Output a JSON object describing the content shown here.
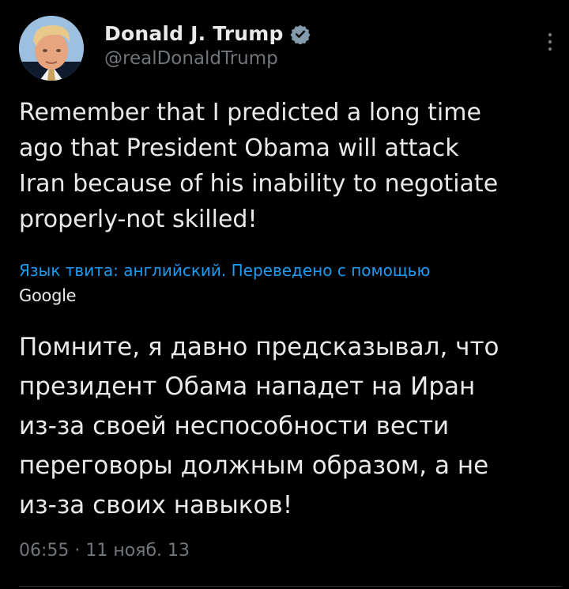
{
  "author": {
    "display_name": "Donald J. Trump",
    "handle": "@realDonaldTrump",
    "verified": true,
    "avatar_icon": "avatar-photo"
  },
  "tweet": {
    "text_lines": [
      "Remember that I predicted a long time",
      "ago that President Obama will attack",
      "Iran because of his inability to negotiate",
      "properly-not skilled!"
    ],
    "translation_note": "Язык твита: английский. Переведено с помощью",
    "translation_provider": "Google",
    "translation_lines": [
      "Помните, я давно предсказывал, что",
      "президент Обама нападет на Иран",
      "из-за своей неспособности вести",
      "переговоры должным образом, а не",
      "из-за своих навыков!"
    ],
    "timestamp": "06:55 · 11 нояб. 13"
  },
  "colors": {
    "background": "#000000",
    "text": "#e7e9ea",
    "muted": "#71767b",
    "link": "#1d9bf0",
    "verified": "#829aab"
  },
  "icons": {
    "verified": "verified-badge-icon",
    "more": "more-vertical-icon"
  }
}
